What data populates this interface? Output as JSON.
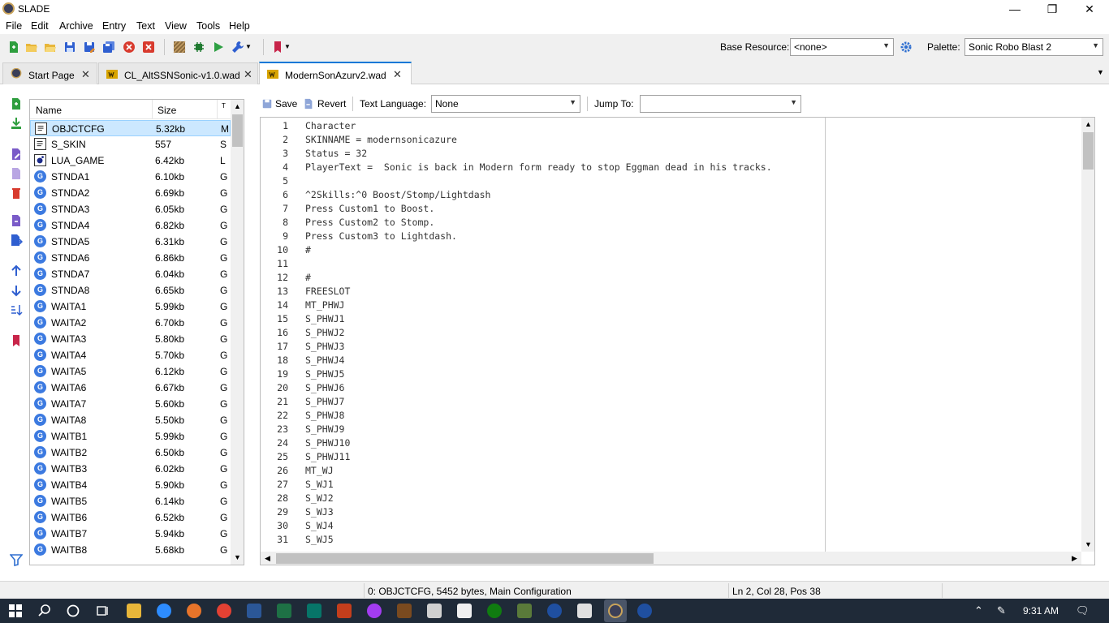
{
  "window": {
    "title": "SLADE",
    "minimize_glyph": "—",
    "maximize_glyph": "❐",
    "close_glyph": "✕"
  },
  "menu": [
    "File",
    "Edit",
    "Archive",
    "Entry",
    "Text",
    "View",
    "Tools",
    "Help"
  ],
  "toolbar": {
    "base_resource_label": "Base Resource:",
    "base_resource_value": "<none>",
    "palette_label": "Palette:",
    "palette_value": "Sonic Robo Blast 2",
    "icons": [
      "new-archive-icon",
      "open-archive-icon",
      "open-directory-icon",
      "save-icon",
      "save-as-icon",
      "save-all-icon",
      "close-archive-icon",
      "close-all-icon",
      "texture-editor-icon",
      "map-editor-icon",
      "run-icon",
      "tools-icon",
      "bookmark-icon"
    ]
  },
  "tabs": [
    {
      "label": "Start Page",
      "icon": "slade-icon",
      "active": false
    },
    {
      "label": "CL_AltSSNSonic-v1.0.wad",
      "icon": "wad-icon",
      "active": false
    },
    {
      "label": "ModernSonAzurv2.wad",
      "icon": "wad-icon",
      "active": true
    }
  ],
  "entry_list": {
    "columns": [
      "Name",
      "Size",
      "T"
    ],
    "rows": [
      {
        "name": "OBJCTCFG",
        "size": "5.32kb",
        "type": "M",
        "icon": "text",
        "selected": true
      },
      {
        "name": "S_SKIN",
        "size": "557",
        "type": "S",
        "icon": "text",
        "selected": false
      },
      {
        "name": "LUA_GAME",
        "size": "6.42kb",
        "type": "L",
        "icon": "lua",
        "selected": false
      },
      {
        "name": "STNDA1",
        "size": "6.10kb",
        "type": "G",
        "icon": "gfx",
        "selected": false
      },
      {
        "name": "STNDA2",
        "size": "6.69kb",
        "type": "G",
        "icon": "gfx",
        "selected": false
      },
      {
        "name": "STNDA3",
        "size": "6.05kb",
        "type": "G",
        "icon": "gfx",
        "selected": false
      },
      {
        "name": "STNDA4",
        "size": "6.82kb",
        "type": "G",
        "icon": "gfx",
        "selected": false
      },
      {
        "name": "STNDA5",
        "size": "6.31kb",
        "type": "G",
        "icon": "gfx",
        "selected": false
      },
      {
        "name": "STNDA6",
        "size": "6.86kb",
        "type": "G",
        "icon": "gfx",
        "selected": false
      },
      {
        "name": "STNDA7",
        "size": "6.04kb",
        "type": "G",
        "icon": "gfx",
        "selected": false
      },
      {
        "name": "STNDA8",
        "size": "6.65kb",
        "type": "G",
        "icon": "gfx",
        "selected": false
      },
      {
        "name": "WAITA1",
        "size": "5.99kb",
        "type": "G",
        "icon": "gfx",
        "selected": false
      },
      {
        "name": "WAITA2",
        "size": "6.70kb",
        "type": "G",
        "icon": "gfx",
        "selected": false
      },
      {
        "name": "WAITA3",
        "size": "5.80kb",
        "type": "G",
        "icon": "gfx",
        "selected": false
      },
      {
        "name": "WAITA4",
        "size": "5.70kb",
        "type": "G",
        "icon": "gfx",
        "selected": false
      },
      {
        "name": "WAITA5",
        "size": "6.12kb",
        "type": "G",
        "icon": "gfx",
        "selected": false
      },
      {
        "name": "WAITA6",
        "size": "6.67kb",
        "type": "G",
        "icon": "gfx",
        "selected": false
      },
      {
        "name": "WAITA7",
        "size": "5.60kb",
        "type": "G",
        "icon": "gfx",
        "selected": false
      },
      {
        "name": "WAITA8",
        "size": "5.50kb",
        "type": "G",
        "icon": "gfx",
        "selected": false
      },
      {
        "name": "WAITB1",
        "size": "5.99kb",
        "type": "G",
        "icon": "gfx",
        "selected": false
      },
      {
        "name": "WAITB2",
        "size": "6.50kb",
        "type": "G",
        "icon": "gfx",
        "selected": false
      },
      {
        "name": "WAITB3",
        "size": "6.02kb",
        "type": "G",
        "icon": "gfx",
        "selected": false
      },
      {
        "name": "WAITB4",
        "size": "5.90kb",
        "type": "G",
        "icon": "gfx",
        "selected": false
      },
      {
        "name": "WAITB5",
        "size": "6.14kb",
        "type": "G",
        "icon": "gfx",
        "selected": false
      },
      {
        "name": "WAITB6",
        "size": "6.52kb",
        "type": "G",
        "icon": "gfx",
        "selected": false
      },
      {
        "name": "WAITB7",
        "size": "5.94kb",
        "type": "G",
        "icon": "gfx",
        "selected": false
      },
      {
        "name": "WAITB8",
        "size": "5.68kb",
        "type": "G",
        "icon": "gfx",
        "selected": false
      }
    ]
  },
  "editor_toolbar": {
    "save_label": "Save",
    "revert_label": "Revert",
    "text_language_label": "Text Language:",
    "text_language_value": "None",
    "jump_to_label": "Jump To:",
    "jump_to_value": ""
  },
  "code_lines": [
    "Character",
    "SKINNAME = modernsonicazure",
    "Status = 32",
    "PlayerText =  Sonic is back in Modern form ready to stop Eggman dead in his tracks.",
    "",
    "^2Skills:^0 Boost/Stomp/Lightdash",
    "Press Custom1 to Boost.",
    "Press Custom2 to Stomp.",
    "Press Custom3 to Lightdash.",
    "#",
    "",
    "#",
    "FREESLOT",
    "MT_PHWJ",
    "S_PHWJ1",
    "S_PHWJ2",
    "S_PHWJ3",
    "S_PHWJ4",
    "S_PHWJ5",
    "S_PHWJ6",
    "S_PHWJ7",
    "S_PHWJ8",
    "S_PHWJ9",
    "S_PHWJ10",
    "S_PHWJ11",
    "MT_WJ",
    "S_WJ1",
    "S_WJ2",
    "S_WJ3",
    "S_WJ4",
    "S_WJ5"
  ],
  "status": {
    "entry_info": "0: OBJCTCFG, 5452 bytes, Main Configuration",
    "cursor_info": "Ln 2, Col 28, Pos 38"
  },
  "taskbar": {
    "time": "9:31 AM"
  },
  "colors": {
    "accent": "#0078d7",
    "selection": "#cce8ff",
    "gfx_icon": "#3c7ae0",
    "taskbar": "#1f2a38"
  }
}
